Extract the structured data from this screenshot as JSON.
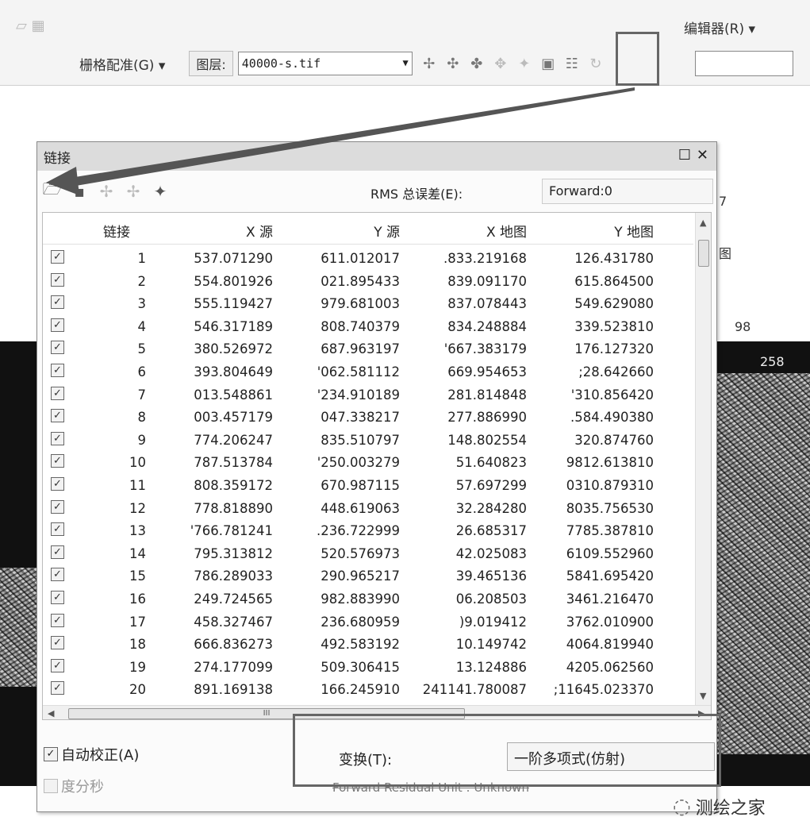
{
  "toolbar": {
    "georef_label": "栅格配准(G) ▾",
    "layer_label": "图层:",
    "layer_value": "40000-s.tif",
    "editor_label": "编辑器(R) ▾"
  },
  "background_labels": [
    "7",
    "图",
    "98",
    "258"
  ],
  "dialog": {
    "title": "链接",
    "rms_label": "RMS 总误差(E):",
    "rms_value": "Forward:0",
    "columns": [
      "链接",
      "X 源",
      "Y 源",
      "X 地图",
      "Y 地图"
    ],
    "rows": [
      {
        "no": "1",
        "x_src": "537.071290",
        "y_src": "611.012017",
        "x_map": ".833.219168",
        "y_map": "126.431780"
      },
      {
        "no": "2",
        "x_src": "554.801926",
        "y_src": "021.895433",
        "x_map": "839.091170",
        "y_map": "615.864500"
      },
      {
        "no": "3",
        "x_src": "555.119427",
        "y_src": "979.681003",
        "x_map": "837.078443",
        "y_map": "549.629080"
      },
      {
        "no": "4",
        "x_src": "546.317189",
        "y_src": "808.740379",
        "x_map": "834.248884",
        "y_map": "339.523810"
      },
      {
        "no": "5",
        "x_src": "380.526972",
        "y_src": "687.963197",
        "x_map": "'667.383179",
        "y_map": "176.127320"
      },
      {
        "no": "6",
        "x_src": "393.804649",
        "y_src": "'062.581112",
        "x_map": "669.954653",
        "y_map": ";28.642660"
      },
      {
        "no": "7",
        "x_src": "013.548861",
        "y_src": "'234.910189",
        "x_map": "281.814848",
        "y_map": "'310.856420"
      },
      {
        "no": "8",
        "x_src": "003.457179",
        "y_src": "047.338217",
        "x_map": "277.886990",
        "y_map": ".584.490380"
      },
      {
        "no": "9",
        "x_src": "774.206247",
        "y_src": "835.510797",
        "x_map": "148.802554",
        "y_map": "320.874760"
      },
      {
        "no": "10",
        "x_src": "787.513784",
        "y_src": "'250.003279",
        "x_map": "51.640823",
        "y_map": "9812.613810"
      },
      {
        "no": "11",
        "x_src": "808.359172",
        "y_src": "670.987115",
        "x_map": "57.697299",
        "y_map": "0310.879310"
      },
      {
        "no": "12",
        "x_src": "778.818890",
        "y_src": "448.619063",
        "x_map": "32.284280",
        "y_map": "8035.756530"
      },
      {
        "no": "13",
        "x_src": "'766.781241",
        "y_src": ".236.722999",
        "x_map": "26.685317",
        "y_map": "7785.387810"
      },
      {
        "no": "14",
        "x_src": "795.313812",
        "y_src": "520.576973",
        "x_map": "42.025083",
        "y_map": "6109.552960"
      },
      {
        "no": "15",
        "x_src": "786.289033",
        "y_src": "290.965217",
        "x_map": "39.465136",
        "y_map": "5841.695420"
      },
      {
        "no": "16",
        "x_src": "249.724565",
        "y_src": "982.883990",
        "x_map": "06.208503",
        "y_map": "3461.216470"
      },
      {
        "no": "17",
        "x_src": "458.327467",
        "y_src": "236.680959",
        "x_map": ")9.019412",
        "y_map": "3762.010900"
      },
      {
        "no": "18",
        "x_src": "666.836273",
        "y_src": "492.583192",
        "x_map": "10.149742",
        "y_map": "4064.819940"
      },
      {
        "no": "19",
        "x_src": "274.177099",
        "y_src": "509.306415",
        "x_map": "13.124886",
        "y_map": "4205.062560"
      },
      {
        "no": "20",
        "x_src": "891.169138",
        "y_src": "166.245910",
        "x_map": "241141.780087",
        "y_map": ";11645.023370"
      }
    ],
    "auto_adjust_label": "自动校正(A)",
    "dms_label": "度分秒",
    "transform_label": "变换(T):",
    "transform_value": "一阶多项式(仿射)",
    "residual_label": "Forward Residual Unit : Unknown",
    "scroll_grip": "III"
  },
  "watermark": "测绘之家"
}
